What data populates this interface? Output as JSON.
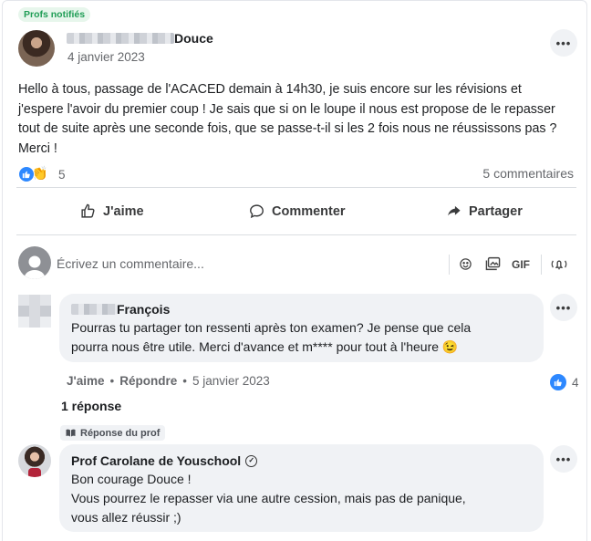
{
  "post": {
    "badge": "Profs notifiés",
    "author_visible": "Douce",
    "date": "4 janvier 2023",
    "text": "Hello à tous, passage de l'ACACED demain à 14h30, je suis encore sur les révisions et j'espere l'avoir du premier coup ! Je sais que si on le loupe il nous est propose de le repasser tout de suite après une seconde fois, que se passe-t-il si les 2 fois nous ne réussissons pas ? Merci !",
    "reaction_count": "5",
    "comments_count": "5 commentaires",
    "more_label": "•••"
  },
  "actions": {
    "like": "J'aime",
    "comment": "Commenter",
    "share": "Partager"
  },
  "composer": {
    "placeholder": "Écrivez un commentaire...",
    "gif": "GIF"
  },
  "comment1": {
    "author_visible": "François",
    "text_line1": "Pourras tu partager ton ressenti après ton examen? Je pense que cela",
    "text_line2": "pourra nous être utile. Merci d'avance et m**** pour tout à l'heure 😉",
    "like": "J'aime",
    "reply": "Répondre",
    "date": "5 janvier 2023",
    "like_count": "4",
    "replies": "1 réponse",
    "dot": "•"
  },
  "prof_reply": {
    "tag": "Réponse du prof",
    "author": "Prof Carolane de Youschool",
    "line1": "Bon courage Douce !",
    "line2": "Vous pourrez le repasser via une autre cession, mais pas de panique,",
    "line3": "vous allez réussir ;)"
  },
  "icons": {
    "like": "thumbs-up-icon",
    "comment": "speech-bubble-icon",
    "share": "share-arrow-icon",
    "emoji": "smiley-icon",
    "image": "image-icon",
    "notify": "bell-icon",
    "verified": "check-circle-icon"
  },
  "colors": {
    "badge_bg": "#e7f6ec",
    "badge_text": "#1f9d55",
    "like_blue": "#2d88ff",
    "bubble_bg": "#f0f2f5"
  }
}
